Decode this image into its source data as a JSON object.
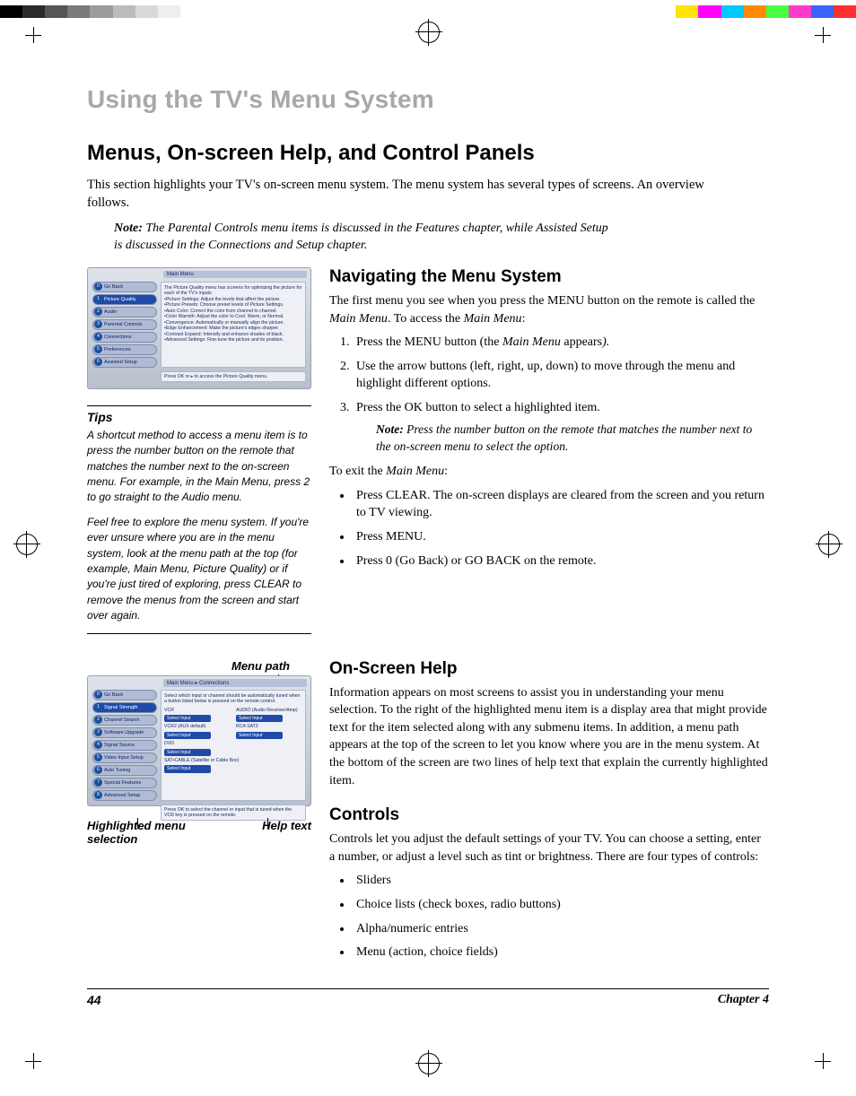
{
  "colorbar": [
    "#000000",
    "#2b2b2b",
    "#555555",
    "#7a7a7a",
    "#9c9c9c",
    "#bcbcbc",
    "#d9d9d9",
    "#eeeeee",
    "#ffffff",
    "#ffffff",
    "#ffffff",
    "#ffffff",
    "#ffffff",
    "#ffffff",
    "#ffffff",
    "#ffffff",
    "#ffffff",
    "#ffffff",
    "#ffffff",
    "#ffffff",
    "#ffffff",
    "#ffffff",
    "#ffffff",
    "#ffffff",
    "#ffffff",
    "#ffffff",
    "#ffffff",
    "#ffffff",
    "#ffffff",
    "#ffffff",
    "#ffe500",
    "#ff00ff",
    "#00c9ff",
    "#ff8a00",
    "#48ff42",
    "#ff3ac8",
    "#3a62ff",
    "#ff2e2e"
  ],
  "chapter_heading": "Using the TV's Menu System",
  "title": "Menus, On-screen Help, and Control Panels",
  "intro": "This section highlights your TV's on-screen menu system. The menu system has several types of screens. An overview follows.",
  "note1_label": "Note:",
  "note1": "The Parental Controls menu items is discussed in the Features chapter, while Assisted Setup is discussed in the Connections and Setup chapter.",
  "nav": {
    "h": "Navigating the Menu System",
    "p1a": "The first menu you see when you press the MENU button on the remote is called the ",
    "p1b": "Main Menu",
    "p1c": ". To access the ",
    "p1d": "Main Menu",
    "p1e": ":",
    "li1a": "Press the MENU button (the ",
    "li1b": "Main Menu",
    "li1c": " appears",
    "li1d": ").",
    "li2": "Use the arrow buttons (left, right, up, down) to move through the menu and highlight different options.",
    "li3": "Press the OK button to select a highlighted item.",
    "inner_label": "Note:",
    "inner": "Press the number button on the remote that matches the number next to the on-screen menu to select the option.",
    "exit_a": "To exit the ",
    "exit_b": "Main Menu",
    "exit_c": ":",
    "b1": "Press CLEAR. The on-screen displays are cleared from the screen and you return to TV viewing.",
    "b2": "Press MENU.",
    "b3": "Press 0 (Go Back) or GO BACK on the remote."
  },
  "tips": {
    "h": "Tips",
    "p1": "A shortcut method to access a menu item is to press the number button on the remote that matches the number next to the on-screen menu. For example, in the Main Menu, press 2 to go straight to the Audio menu.",
    "p2": "Feel free to explore the menu system. If you're ever unsure where you are in the menu system, look at the menu path at the top (for example, Main Menu, Picture Quality) or if you're just tired of exploring, press CLEAR to remove the menus from the screen and start over again."
  },
  "fig1": {
    "crumb": "Main Menu",
    "items": [
      {
        "n": "0",
        "t": "Go Back",
        "sel": false
      },
      {
        "n": "1",
        "t": "Picture Quality",
        "sel": true
      },
      {
        "n": "2",
        "t": "Audio",
        "sel": false
      },
      {
        "n": "3",
        "t": "Parental Controls",
        "sel": false
      },
      {
        "n": "4",
        "t": "Connections",
        "sel": false
      },
      {
        "n": "5",
        "t": "Preferences",
        "sel": false
      },
      {
        "n": "6",
        "t": "Assisted Setup",
        "sel": false
      }
    ],
    "desc": "The Picture Quality menu has screens for optimizing the picture for each of the TV's inputs:\n•Picture Settings: Adjust the levels that affect the picture.\n•Picture Presets: Choose preset levels of Picture Settings.\n•Auto Color: Correct the color from channel to channel.\n•Color Warmth: Adjust the color to Cool, Warm, or Normal.\n•Convergence: Automatically or manually align the picture.\n•Edge Enhancement: Make the picture's edges sharper.\n•Contrast Expand: Intensify and enhance shades of black.\n•Advanced Settings: Fine-tune the picture and its position.",
    "foot": "Press OK or ▸ to access the Picture Quality menu."
  },
  "caption1": "Menu path",
  "fig2": {
    "crumb": "Main Menu ▸ Connections",
    "items": [
      {
        "n": "0",
        "t": "Go Back",
        "sel": false
      },
      {
        "n": "1",
        "t": "Signal Strength",
        "sel": true
      },
      {
        "n": "2",
        "t": "Channel Search",
        "sel": false
      },
      {
        "n": "3",
        "t": "Software Upgrade",
        "sel": false
      },
      {
        "n": "4",
        "t": "Signal Source",
        "sel": false
      },
      {
        "n": "5",
        "t": "Video Input Setup",
        "sel": false
      },
      {
        "n": "6",
        "t": "Auto Tuning",
        "sel": false
      },
      {
        "n": "7",
        "t": "Special Features",
        "sel": false
      },
      {
        "n": "8",
        "t": "Advanced Setup",
        "sel": false
      }
    ],
    "desc_top": "Select which input or channel should be automatically tuned when a button listed below is pressed on the remote control.",
    "groups": [
      {
        "l": "VCR",
        "r": "AUDIO (Audio Receiver/Amp)"
      },
      {
        "l": "VCR2 (AUX default)",
        "r": "RCA SAT2"
      },
      {
        "l": "DVD",
        "r": ""
      },
      {
        "l": "SAT•CABLE (Satellite or Cable Box)",
        "r": ""
      }
    ],
    "select_label": "Select Input",
    "foot": "Press OK to select the channel or input that is tuned when the VCR key is pressed on the remote."
  },
  "caption_left": "Highlighted menu selection",
  "caption_right": "Help text",
  "osh": {
    "h": "On-Screen Help",
    "p": "Information appears on most screens to assist you in understanding your menu selection. To the right of the highlighted menu item is a display area that might provide text for the item selected along with any submenu items. In addition, a menu path appears at the top of the screen to let you know where you are in the menu system. At the bottom of the screen are two lines of help text that explain the currently highlighted item."
  },
  "ctrl": {
    "h": "Controls",
    "p": "Controls let you adjust the default settings of your TV. You can choose a setting, enter a number, or adjust a level such as tint or brightness. There are four types of controls:",
    "items": [
      "Sliders",
      "Choice lists (check boxes, radio buttons)",
      "Alpha/numeric entries",
      "Menu (action, choice fields)"
    ]
  },
  "footer": {
    "page": "44",
    "chapter": "Chapter 4"
  }
}
